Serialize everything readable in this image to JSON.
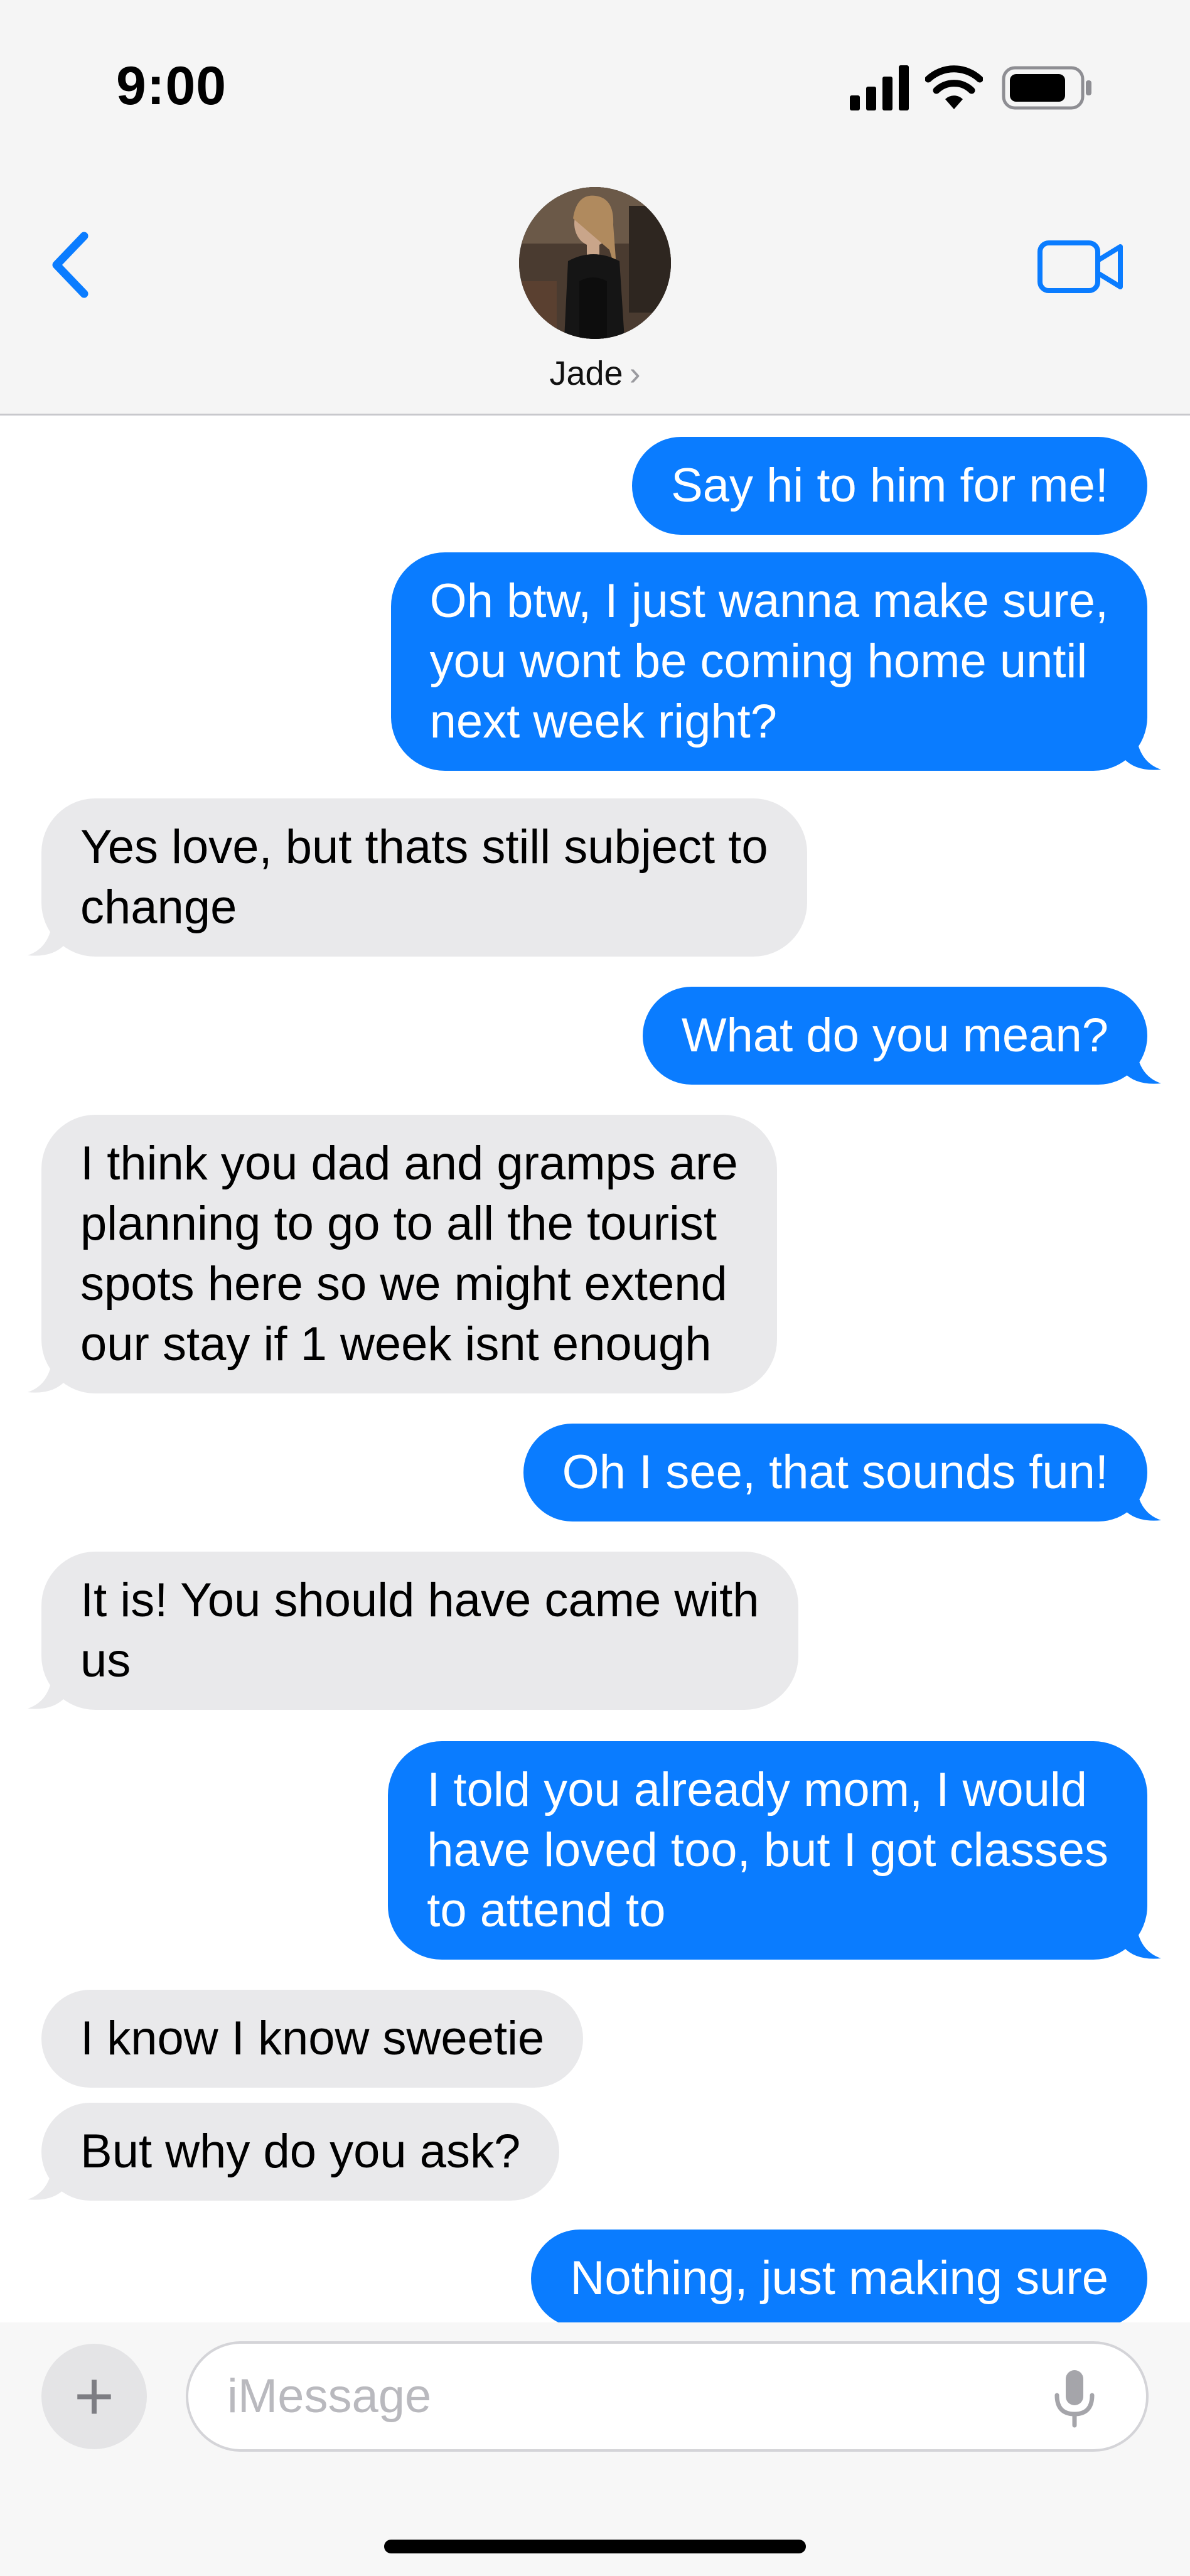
{
  "status_bar": {
    "time": "9:00"
  },
  "header": {
    "contact_name": "Jade",
    "name_chevron": "›",
    "icons": {
      "back": "chevron-left-icon",
      "video": "video-camera-icon"
    },
    "accent_color": "#0a7cff"
  },
  "messages": [
    {
      "side": "sent",
      "text": "Say hi to him for me!"
    },
    {
      "side": "sent",
      "lines": [
        "Oh btw, I just wanna make sure,",
        "you wont be coming home until",
        "next week right?"
      ]
    },
    {
      "side": "recv",
      "lines": [
        "Yes love, but thats still subject to",
        "change"
      ]
    },
    {
      "side": "sent",
      "text": "What do you mean?"
    },
    {
      "side": "recv",
      "lines": [
        "I think you dad and gramps are",
        "planning to go to all the tourist",
        "spots here so we might extend",
        "our stay if 1 week isnt enough"
      ]
    },
    {
      "side": "sent",
      "text": "Oh I see, that sounds fun!"
    },
    {
      "side": "recv",
      "lines": [
        "It is! You should have came with",
        "us"
      ]
    },
    {
      "side": "sent",
      "lines": [
        "I told you already mom, I would",
        "have loved too, but I got classes",
        "to attend to"
      ]
    },
    {
      "side": "recv",
      "text": "I know I know sweetie"
    },
    {
      "side": "recv",
      "text": "But why do you ask?"
    },
    {
      "side": "sent",
      "text": "Nothing, just making sure"
    }
  ],
  "composer": {
    "plus_label": "+",
    "placeholder": "iMessage",
    "icons": {
      "plus": "plus-icon",
      "mic": "microphone-icon"
    }
  },
  "colors": {
    "sent_bubble": "#0a7cff",
    "received_bubble": "#e9e9eb",
    "header_bg": "#f5f5f5"
  }
}
